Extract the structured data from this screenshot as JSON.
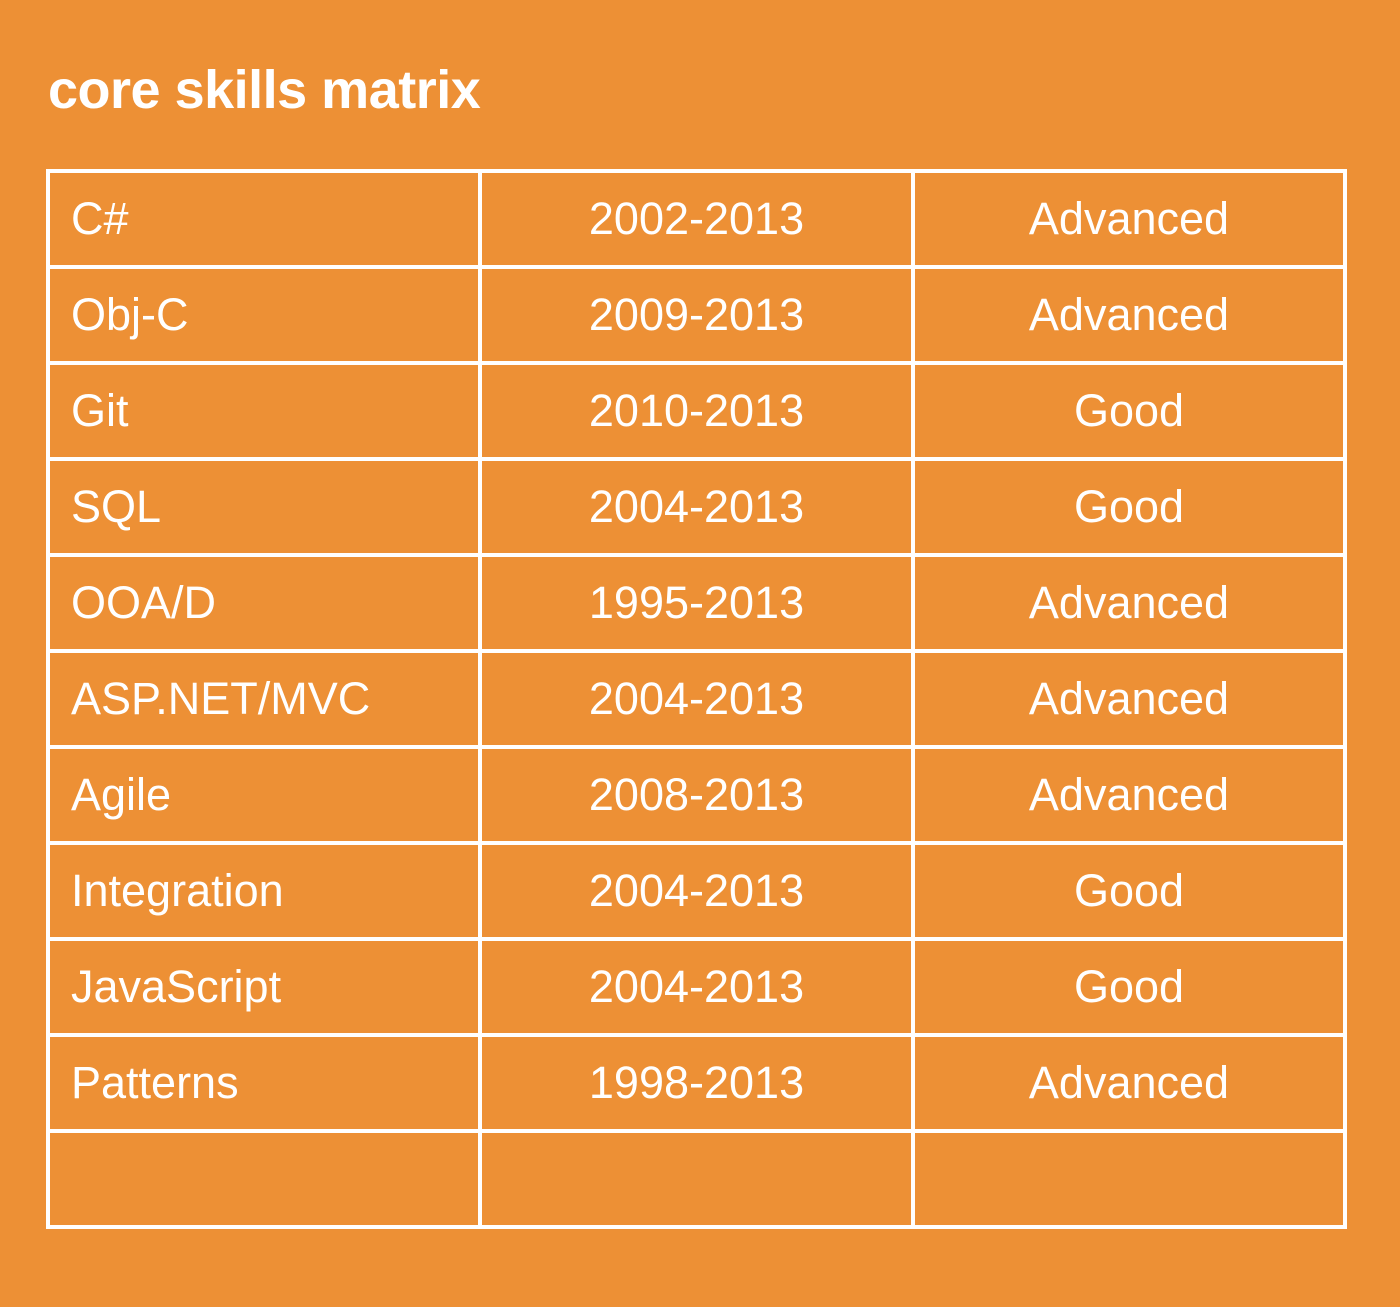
{
  "title": "core skills matrix",
  "colors": {
    "background": "#ED9035",
    "foreground": "#FFFFFF"
  },
  "rows": [
    {
      "skill": "C#",
      "years": "2002-2013",
      "level": "Advanced"
    },
    {
      "skill": "Obj-C",
      "years": "2009-2013",
      "level": "Advanced"
    },
    {
      "skill": "Git",
      "years": "2010-2013",
      "level": "Good"
    },
    {
      "skill": "SQL",
      "years": "2004-2013",
      "level": "Good"
    },
    {
      "skill": "OOA/D",
      "years": "1995-2013",
      "level": "Advanced"
    },
    {
      "skill": "ASP.NET/MVC",
      "years": "2004-2013",
      "level": "Advanced"
    },
    {
      "skill": "Agile",
      "years": "2008-2013",
      "level": "Advanced"
    },
    {
      "skill": "Integration",
      "years": "2004-2013",
      "level": "Good"
    },
    {
      "skill": "JavaScript",
      "years": "2004-2013",
      "level": "Good"
    },
    {
      "skill": "Patterns",
      "years": "1998-2013",
      "level": "Advanced"
    },
    {
      "skill": "",
      "years": "",
      "level": ""
    }
  ]
}
